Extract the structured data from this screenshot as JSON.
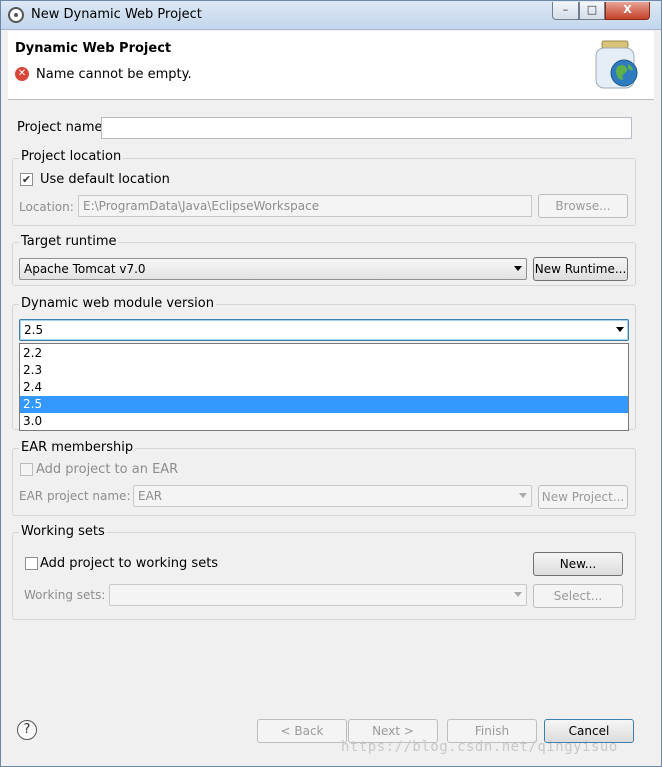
{
  "window": {
    "title": "New Dynamic Web Project",
    "controls": {
      "minimize": "–",
      "maximize": "□",
      "close": "X"
    }
  },
  "header": {
    "title": "Dynamic Web Project",
    "error_message": "Name cannot be empty.",
    "error_icon": "error-icon",
    "banner_icon": "web-project-jar-globe-icon"
  },
  "project_name": {
    "label": "Project name:",
    "value": ""
  },
  "project_location": {
    "group_title": "Project location",
    "use_default_label": "Use default location",
    "use_default_checked": true,
    "location_label": "Location:",
    "location_value": "E:\\ProgramData\\Java\\EclipseWorkspace",
    "browse_label": "Browse..."
  },
  "target_runtime": {
    "group_title": "Target runtime",
    "selected": "Apache Tomcat v7.0",
    "new_runtime_label": "New Runtime..."
  },
  "module_version": {
    "group_title": "Dynamic web module version",
    "selected": "2.5",
    "options": [
      "2.2",
      "2.3",
      "2.4",
      "2.5",
      "3.0"
    ]
  },
  "ear_membership": {
    "group_title": "EAR membership",
    "add_to_ear_label": "Add project to an EAR",
    "add_to_ear_checked": false,
    "ear_project_label": "EAR project name:",
    "ear_project_value": "EAR",
    "new_project_label": "New Project..."
  },
  "working_sets": {
    "group_title": "Working sets",
    "add_label": "Add project to working sets",
    "add_checked": false,
    "new_label": "New...",
    "working_sets_label": "Working sets:",
    "working_sets_value": "",
    "select_label": "Select..."
  },
  "footer": {
    "help": "?",
    "back_label": "< Back",
    "next_label": "Next >",
    "finish_label": "Finish",
    "cancel_label": "Cancel"
  },
  "watermark": "https://blog.csdn.net/qingyisuo"
}
